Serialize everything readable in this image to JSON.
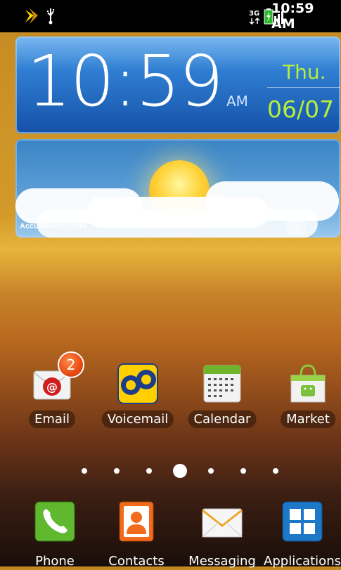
{
  "status_bar": {
    "time": "10:59 AM",
    "network": "3G",
    "icons": [
      "sprint-logo-icon",
      "usb-icon",
      "3g-icon",
      "signal-icon",
      "battery-icon"
    ]
  },
  "clock_widget": {
    "time": "10:59",
    "ampm": "AM",
    "day": "Thu.",
    "date": "06/07"
  },
  "weather_widget": {
    "brand": "AccuWeather.com"
  },
  "home_apps": [
    {
      "label": "Email",
      "badge": "2",
      "icon": "email-icon"
    },
    {
      "label": "Voicemail",
      "icon": "voicemail-icon"
    },
    {
      "label": "Calendar",
      "icon": "calendar-icon"
    },
    {
      "label": "Market",
      "icon": "market-icon"
    }
  ],
  "page_indicator": {
    "pages": 7,
    "current": 4
  },
  "dock": [
    {
      "label": "Phone",
      "icon": "phone-icon"
    },
    {
      "label": "Contacts",
      "icon": "contacts-icon"
    },
    {
      "label": "Messaging",
      "icon": "messaging-icon"
    },
    {
      "label": "Applications",
      "icon": "applications-icon"
    }
  ]
}
